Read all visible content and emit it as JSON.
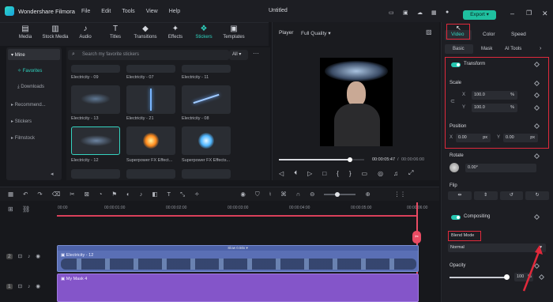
{
  "app": {
    "name": "Wondershare Filmora",
    "menus": [
      "File",
      "Edit",
      "Tools",
      "View",
      "Help"
    ],
    "document_title": "Untitled",
    "export_label": "Export"
  },
  "toolbar": {
    "tools": [
      {
        "label": "Media",
        "icon": "media-icon"
      },
      {
        "label": "Stock Media",
        "icon": "stock-media-icon"
      },
      {
        "label": "Audio",
        "icon": "audio-icon"
      },
      {
        "label": "Titles",
        "icon": "titles-icon"
      },
      {
        "label": "Transitions",
        "icon": "transitions-icon"
      },
      {
        "label": "Effects",
        "icon": "effects-icon"
      },
      {
        "label": "Stickers",
        "icon": "stickers-icon"
      },
      {
        "label": "Templates",
        "icon": "templates-icon"
      }
    ]
  },
  "sidebar": {
    "items": [
      "Mine",
      "Favorites",
      "Downloads",
      "Recommend...",
      "Stickers",
      "Filmstock"
    ]
  },
  "stickers": {
    "search_placeholder": "Search my favorite stickers",
    "filter": "All",
    "top_row_labels": [
      "Electricity - 09",
      "Electricity - 07",
      "Electricity - 11"
    ],
    "mid_row_labels": [
      "Electricity - 13",
      "Electricity - 21",
      "Electricity - 08"
    ],
    "bottom_row_labels": [
      "Electricity - 12",
      "Superpower FX Effect...",
      "Superpower FX Effects..."
    ]
  },
  "player": {
    "label": "Player",
    "quality": "Full Quality",
    "current_time": "00:00:05:47",
    "total_time": "00:00:06:00",
    "progress": 0.83
  },
  "inspector": {
    "tabs": [
      "Video",
      "Color",
      "Speed"
    ],
    "subtabs": [
      "Basic",
      "Mask",
      "AI Tools"
    ],
    "transform_label": "Transform",
    "scale_label": "Scale",
    "scale_x": "100.0",
    "scale_y": "100.0",
    "scale_unit": "%",
    "axis_x": "X",
    "axis_y": "Y",
    "position_label": "Position",
    "pos_x": "0.00",
    "pos_y": "0.00",
    "pos_unit": "px",
    "rotate_label": "Rotate",
    "rotate_value": "0.00°",
    "flip_label": "Flip",
    "compositing_label": "Compositing",
    "blend_mode_label": "Blend Mode",
    "blend_mode_value": "Normal",
    "opacity_label": "Opacity",
    "opacity_value": "100",
    "opacity_unit": "%",
    "opacity_level": 1.0
  },
  "timeline": {
    "ruler": [
      "00:00",
      "00:00:01:00",
      "00:00:02:00",
      "00:00:03:00",
      "00:00:04:00",
      "00:00:05:00",
      "00:00:06:00"
    ],
    "track1_clip": "Electricity - 12",
    "track1_speed": "Slow 0.50x",
    "track2_clip": "My Mask 4",
    "track1_number": "2",
    "track2_number": "1"
  },
  "colors": {
    "accent": "#2fd4c0",
    "highlight_box": "#e0293b",
    "clip_blue": "#5a6fb5",
    "clip_purple": "#8455c9"
  }
}
